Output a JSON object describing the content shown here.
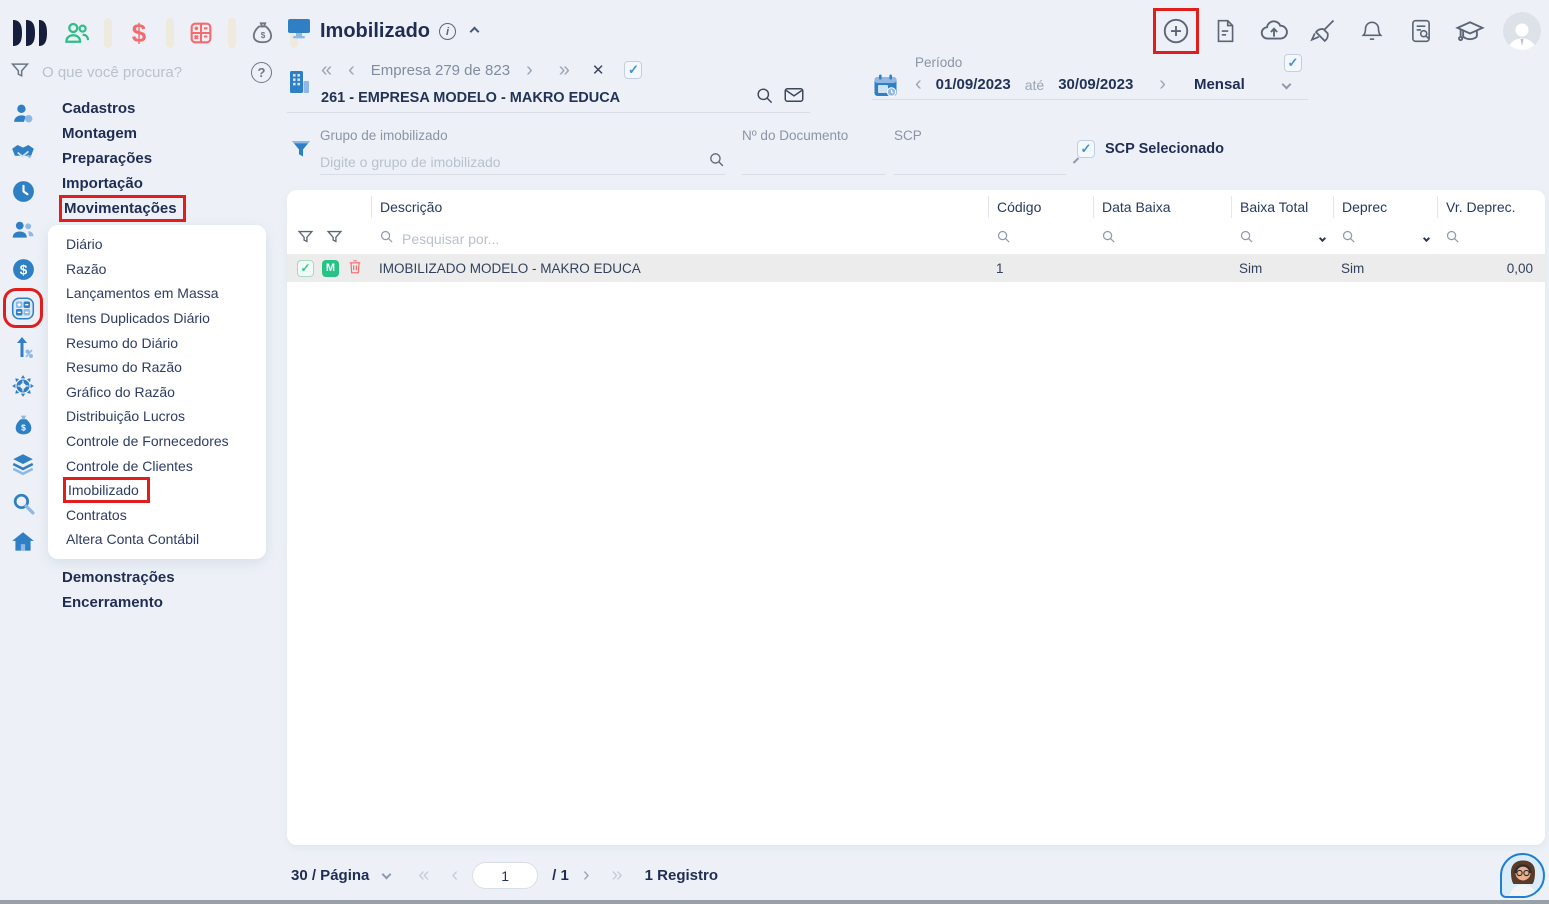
{
  "app": {
    "search_placeholder": "O que você procura?",
    "topbar_icons": [
      "people-icon",
      "dollar-icon",
      "calculator-icon",
      "money-bag-icon"
    ],
    "rail_icons": [
      "person-gear-icon",
      "handshake-icon",
      "clock-icon",
      "people-icon",
      "dollar-circle-icon",
      "calculator-icon",
      "trending-up-icon",
      "gear-icon",
      "money-bag-icon",
      "layers-icon",
      "search-icon",
      "home-icon"
    ],
    "dollar_glyph": "$"
  },
  "sidebar": {
    "sections": [
      "Cadastros",
      "Montagem",
      "Preparações",
      "Importação"
    ],
    "active_section": "Movimentações",
    "submenu": [
      "Diário",
      "Razão",
      "Lançamentos em Massa",
      "Itens Duplicados Diário",
      "Resumo do Diário",
      "Resumo do Razão",
      "Gráfico do Razão",
      "Distribuição Lucros",
      "Controle de Fornecedores",
      "Controle de Clientes",
      "Imobilizado",
      "Contratos",
      "Altera Conta Contábil"
    ],
    "bottom_sections": [
      "Demonstrações",
      "Encerramento"
    ]
  },
  "header": {
    "title": "Imobilizado",
    "company_nav_label": "Empresa 279 de 823",
    "company_name": "261 - EMPRESA MODELO - MAKRO EDUCA",
    "period": {
      "label": "Período",
      "start": "01/09/2023",
      "separator": "até",
      "end": "30/09/2023",
      "mode": "Mensal"
    },
    "action_icons": [
      "plus-circle-icon",
      "file-icon",
      "cloud-upload-icon",
      "broom-icon",
      "bell-icon",
      "file-search-icon",
      "graduation-cap-icon",
      "avatar"
    ]
  },
  "filters": {
    "group_label": "Grupo de imobilizado",
    "group_placeholder": "Digite o grupo de imobilizado",
    "doc_label": "Nº do Documento",
    "scp_label": "SCP",
    "scp_selected_label": "SCP Selecionado",
    "checkmark": "✓"
  },
  "table": {
    "columns": [
      "Descrição",
      "Código",
      "Data Baixa",
      "Baixa Total",
      "Deprec",
      "Vr. Deprec."
    ],
    "search_placeholder": "Pesquisar por...",
    "rows": [
      {
        "checked": "✓",
        "badge": "M",
        "descricao": "IMOBILIZADO MODELO - MAKRO EDUCA",
        "codigo": "1",
        "data_baixa": "",
        "baixa_total": "Sim",
        "deprec": "Sim",
        "vr_deprec": "0,00"
      }
    ]
  },
  "pagination": {
    "per_page": "30 / Página",
    "first": "«",
    "prev": "‹",
    "page_value": "1",
    "of_pages": "/ 1",
    "next": "›",
    "last": "»",
    "records": "1 Registro"
  },
  "nav_glyphs": {
    "first": "«",
    "prev": "‹",
    "next": "›",
    "last": "»",
    "close": "✕",
    "info": "i",
    "help": "?"
  },
  "colors": {
    "page_bg": "#edf1f7",
    "accent_blue": "#2f7fc4",
    "navy_text": "#1f2d54",
    "green": "#27c285",
    "coral_red": "#f46a6d",
    "highlight_red": "#e01f1d",
    "row_bg": "#ececec"
  }
}
